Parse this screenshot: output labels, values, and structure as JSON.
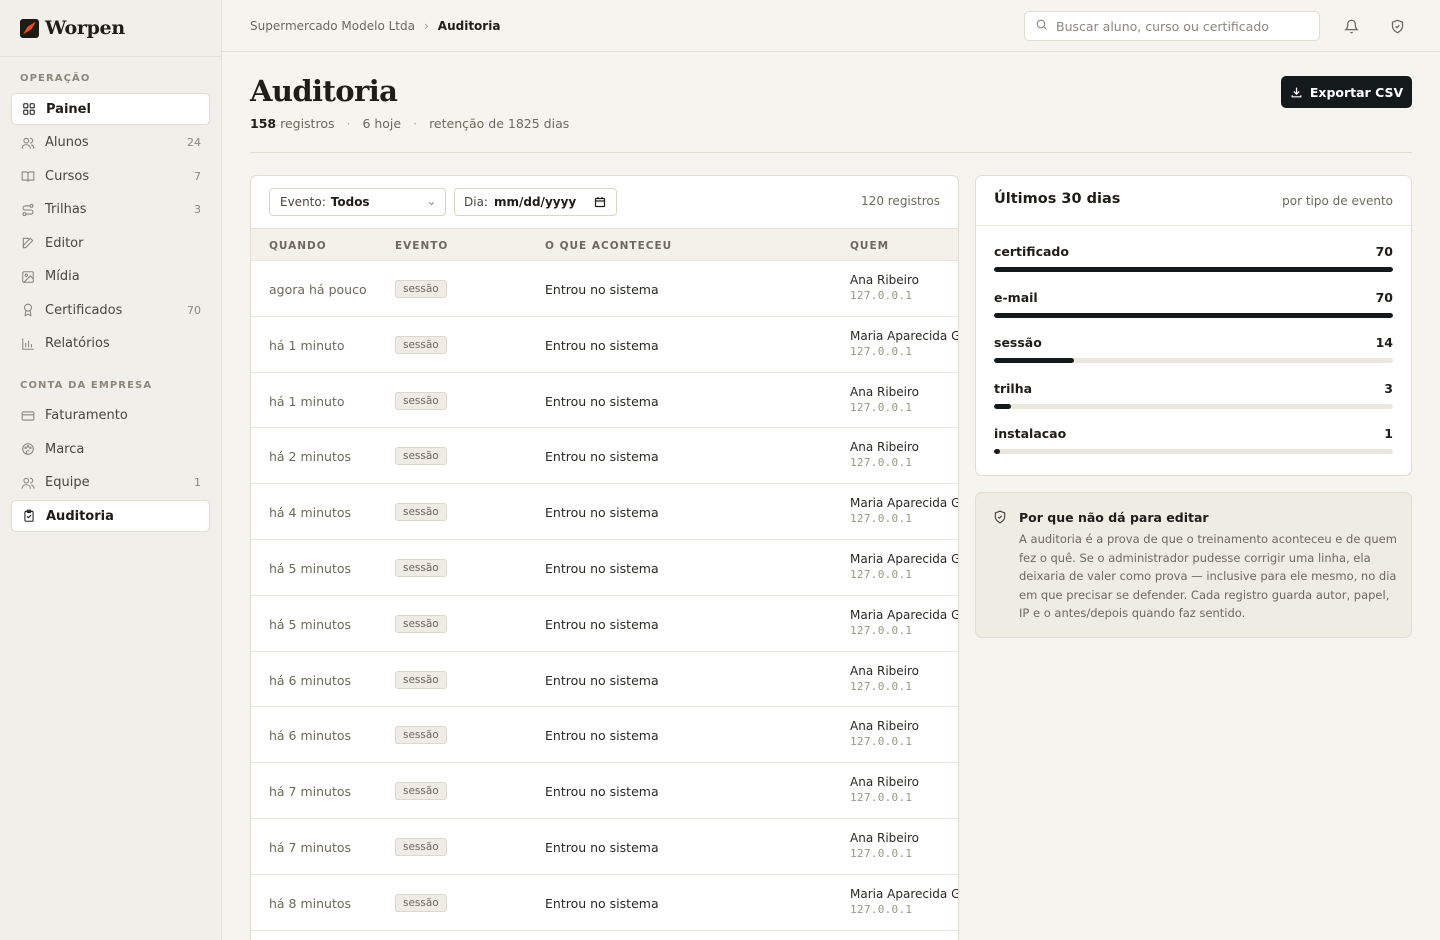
{
  "brand": {
    "name": "Worpen"
  },
  "sidebar": {
    "section_operacao": "OPERAÇÃO",
    "section_empresa": "CONTA DA EMPRESA",
    "items": [
      {
        "label": "Painel",
        "icon": "grid-icon",
        "count": "",
        "active": true
      },
      {
        "label": "Alunos",
        "icon": "users-icon",
        "count": "24",
        "active": false
      },
      {
        "label": "Cursos",
        "icon": "book-icon",
        "count": "7",
        "active": false
      },
      {
        "label": "Trilhas",
        "icon": "route-icon",
        "count": "3",
        "active": false
      },
      {
        "label": "Editor",
        "icon": "edit-icon",
        "count": "",
        "active": false
      },
      {
        "label": "Mídia",
        "icon": "image-icon",
        "count": "",
        "active": false
      },
      {
        "label": "Certificados",
        "icon": "award-icon",
        "count": "70",
        "active": false
      },
      {
        "label": "Relatórios",
        "icon": "bar-chart-icon",
        "count": "",
        "active": false
      }
    ],
    "company_items": [
      {
        "label": "Faturamento",
        "icon": "credit-card-icon",
        "count": "",
        "active": false
      },
      {
        "label": "Marca",
        "icon": "palette-icon",
        "count": "",
        "active": false
      },
      {
        "label": "Equipe",
        "icon": "users-icon",
        "count": "1",
        "active": false
      },
      {
        "label": "Auditoria",
        "icon": "clipboard-check-icon",
        "count": "",
        "active": true
      }
    ]
  },
  "topbar": {
    "breadcrumb_parent": "Supermercado Modelo Ltda",
    "breadcrumb_current": "Auditoria",
    "search_placeholder": "Buscar aluno, curso ou certificado"
  },
  "header": {
    "title": "Auditoria",
    "records_count": "158",
    "records_label": "registros",
    "today": "6 hoje",
    "retention": "retenção de 1825 dias",
    "export_label": "Exportar CSV"
  },
  "filters": {
    "event_label": "Evento:",
    "event_value": "Todos",
    "day_label": "Dia:",
    "day_value": "mm/dd/yyyy",
    "result_count": "120 registros"
  },
  "table": {
    "columns": [
      "QUANDO",
      "EVENTO",
      "O QUE ACONTECEU",
      "QUEM"
    ],
    "rows": [
      {
        "when": "agora há pouco",
        "event": "sessão",
        "what": "Entrou no sistema",
        "who": "Ana Ribeiro",
        "ip": "127.0.0.1"
      },
      {
        "when": "há 1 minuto",
        "event": "sessão",
        "what": "Entrou no sistema",
        "who": "Maria Aparecida Gomes",
        "ip": "127.0.0.1"
      },
      {
        "when": "há 1 minuto",
        "event": "sessão",
        "what": "Entrou no sistema",
        "who": "Ana Ribeiro",
        "ip": "127.0.0.1"
      },
      {
        "when": "há 2 minutos",
        "event": "sessão",
        "what": "Entrou no sistema",
        "who": "Ana Ribeiro",
        "ip": "127.0.0.1"
      },
      {
        "when": "há 4 minutos",
        "event": "sessão",
        "what": "Entrou no sistema",
        "who": "Maria Aparecida Gomes",
        "ip": "127.0.0.1"
      },
      {
        "when": "há 5 minutos",
        "event": "sessão",
        "what": "Entrou no sistema",
        "who": "Maria Aparecida Gomes",
        "ip": "127.0.0.1"
      },
      {
        "when": "há 5 minutos",
        "event": "sessão",
        "what": "Entrou no sistema",
        "who": "Maria Aparecida Gomes",
        "ip": "127.0.0.1"
      },
      {
        "when": "há 6 minutos",
        "event": "sessão",
        "what": "Entrou no sistema",
        "who": "Ana Ribeiro",
        "ip": "127.0.0.1"
      },
      {
        "when": "há 6 minutos",
        "event": "sessão",
        "what": "Entrou no sistema",
        "who": "Ana Ribeiro",
        "ip": "127.0.0.1"
      },
      {
        "when": "há 7 minutos",
        "event": "sessão",
        "what": "Entrou no sistema",
        "who": "Ana Ribeiro",
        "ip": "127.0.0.1"
      },
      {
        "when": "há 7 minutos",
        "event": "sessão",
        "what": "Entrou no sistema",
        "who": "Ana Ribeiro",
        "ip": "127.0.0.1"
      },
      {
        "when": "há 8 minutos",
        "event": "sessão",
        "what": "Entrou no sistema",
        "who": "Maria Aparecida Gomes",
        "ip": "127.0.0.1"
      }
    ]
  },
  "stats": {
    "title": "Últimos 30 dias",
    "note": "por tipo de evento",
    "max": 70,
    "items": [
      {
        "label": "certificado",
        "value": 70
      },
      {
        "label": "e-mail",
        "value": 70
      },
      {
        "label": "sessão",
        "value": 14
      },
      {
        "label": "trilha",
        "value": 3
      },
      {
        "label": "instalacao",
        "value": 1
      }
    ]
  },
  "info": {
    "title": "Por que não dá para editar",
    "text": "A auditoria é a prova de que o treinamento aconteceu e de quem fez o quê. Se o administrador pudesse corrigir uma linha, ela deixaria de valer como prova — inclusive para ele mesmo, no dia em que precisar se defender. Cada registro guarda autor, papel, IP e o antes/depois quando faz sentido."
  },
  "colors": {
    "accent": "#e8501c",
    "dark": "#14191c",
    "background": "#f6f4ef"
  }
}
